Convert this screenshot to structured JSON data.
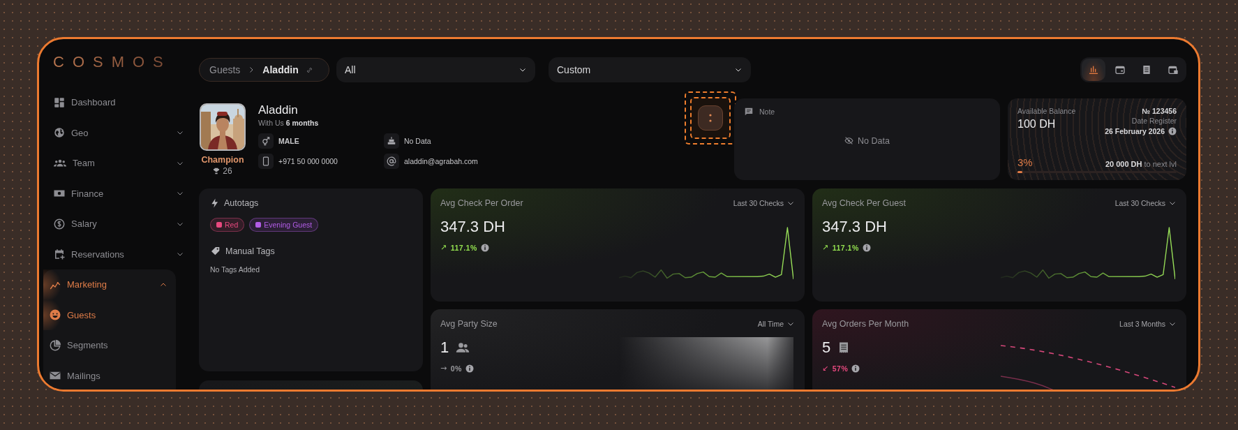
{
  "logo": "COSMOS",
  "sidebar": {
    "items": [
      {
        "label": "Dashboard",
        "kind": "link",
        "selected": false
      },
      {
        "label": "Geo",
        "kind": "group",
        "selected": false,
        "expanded": false
      },
      {
        "label": "Team",
        "kind": "group",
        "selected": false,
        "expanded": false
      },
      {
        "label": "Finance",
        "kind": "group",
        "selected": false,
        "expanded": false
      },
      {
        "label": "Salary",
        "kind": "group",
        "selected": false,
        "expanded": false
      },
      {
        "label": "Reservations",
        "kind": "group",
        "selected": false,
        "expanded": false
      },
      {
        "label": "Marketing",
        "kind": "group",
        "selected": true,
        "expanded": true,
        "children": [
          {
            "label": "Guests",
            "selected": true
          },
          {
            "label": "Segments",
            "selected": false
          },
          {
            "label": "Mailings",
            "selected": false
          }
        ]
      }
    ]
  },
  "breadcrumb": {
    "parent": "Guests",
    "current": "Aladdin"
  },
  "filters": [
    {
      "value": "All"
    },
    {
      "value": "Custom"
    }
  ],
  "view_switcher": [
    {
      "selected": true
    },
    {
      "selected": false
    },
    {
      "selected": false
    },
    {
      "selected": false
    }
  ],
  "profile": {
    "name": "Aladdin",
    "tenure": "With Us **6 months**",
    "tier": "Champion",
    "points": "26",
    "gender": "MALE",
    "birthday": "No Data",
    "phone": "+971 50 000 0000",
    "email": "aladdin@agrabah.com"
  },
  "note": {
    "title": "Note",
    "empty": "No Data"
  },
  "balance": {
    "label": "Available Balance",
    "amount": "100 DH",
    "number": "№ 123456",
    "date_label": "Date Register",
    "date": "26 February 2026",
    "percent": "3%",
    "level": 0.03,
    "to_next": "**20 000 DH** to next lvl"
  },
  "tags": {
    "autotags_title": "Autotags",
    "autotags": [
      {
        "label": "Red",
        "color": "#e8497f"
      },
      {
        "label": "Evening Guest",
        "color": "#b25ce6"
      }
    ],
    "manual_title": "Manual Tags",
    "manual_empty": "No Tags Added"
  },
  "metrics": [
    {
      "title": "Avg Check Per Order",
      "period": "Last 30 Checks",
      "value": "347.3 DH",
      "arrow": "↗",
      "change": "117.1%",
      "color": "#93e04f",
      "kind": "line"
    },
    {
      "title": "Avg Check Per Guest",
      "period": "Last 30 Checks",
      "value": "347.3 DH",
      "arrow": "↗",
      "change": "117.1%",
      "color": "#93e04f",
      "kind": "line"
    },
    {
      "title": "Avg Party Size",
      "period": "All Time",
      "value": "1",
      "arrow": "→",
      "change": "0%",
      "color": "#9a9a9e",
      "kind": "party"
    },
    {
      "title": "Avg Orders Per Month",
      "period": "Last 3 Months",
      "value": "5",
      "arrow": "↙",
      "change": "57%",
      "color": "#e8497f",
      "kind": "orders"
    }
  ]
}
